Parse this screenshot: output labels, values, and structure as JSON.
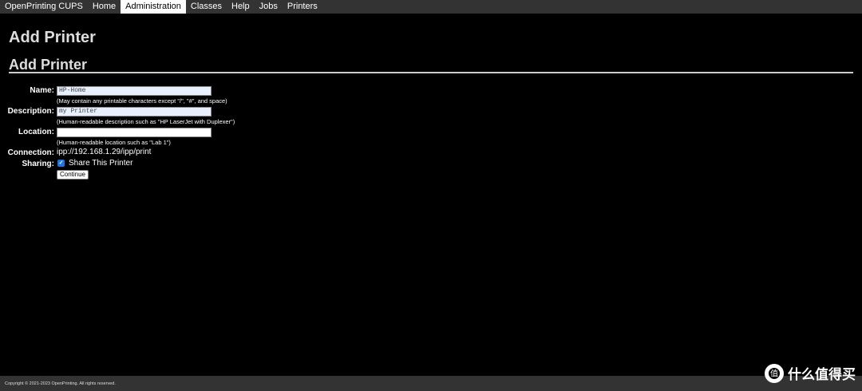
{
  "nav": {
    "items": [
      {
        "label": "OpenPrinting CUPS"
      },
      {
        "label": "Home"
      },
      {
        "label": "Administration"
      },
      {
        "label": "Classes"
      },
      {
        "label": "Help"
      },
      {
        "label": "Jobs"
      },
      {
        "label": "Printers"
      }
    ],
    "active": "Administration"
  },
  "page": {
    "title": "Add Printer",
    "section_title": "Add Printer"
  },
  "form": {
    "name": {
      "label": "Name:",
      "value": "HP-Home",
      "hint": "(May contain any printable characters except \"/\", \"#\", and space)"
    },
    "description": {
      "label": "Description:",
      "value": "my Printer",
      "hint": "(Human-readable description such as \"HP LaserJet with Duplexer\")"
    },
    "location": {
      "label": "Location:",
      "value": "",
      "hint": "(Human-readable location such as \"Lab 1\")"
    },
    "connection": {
      "label": "Connection:",
      "value": "ipp://192.168.1.29/ipp/print"
    },
    "sharing": {
      "label": "Sharing:",
      "checked": true,
      "checkbox_label": "Share This Printer"
    },
    "continue_label": "Continue"
  },
  "footer": {
    "copyright": "Copyright © 2021-2023 OpenPrinting. All rights reserved."
  },
  "watermark": {
    "text": "什么值得买",
    "logo_glyph": "值"
  },
  "colors": {
    "background": "#000000",
    "navbar": "#333333",
    "active_tab": "#ffffff",
    "checkbox": "#1a73e8"
  }
}
